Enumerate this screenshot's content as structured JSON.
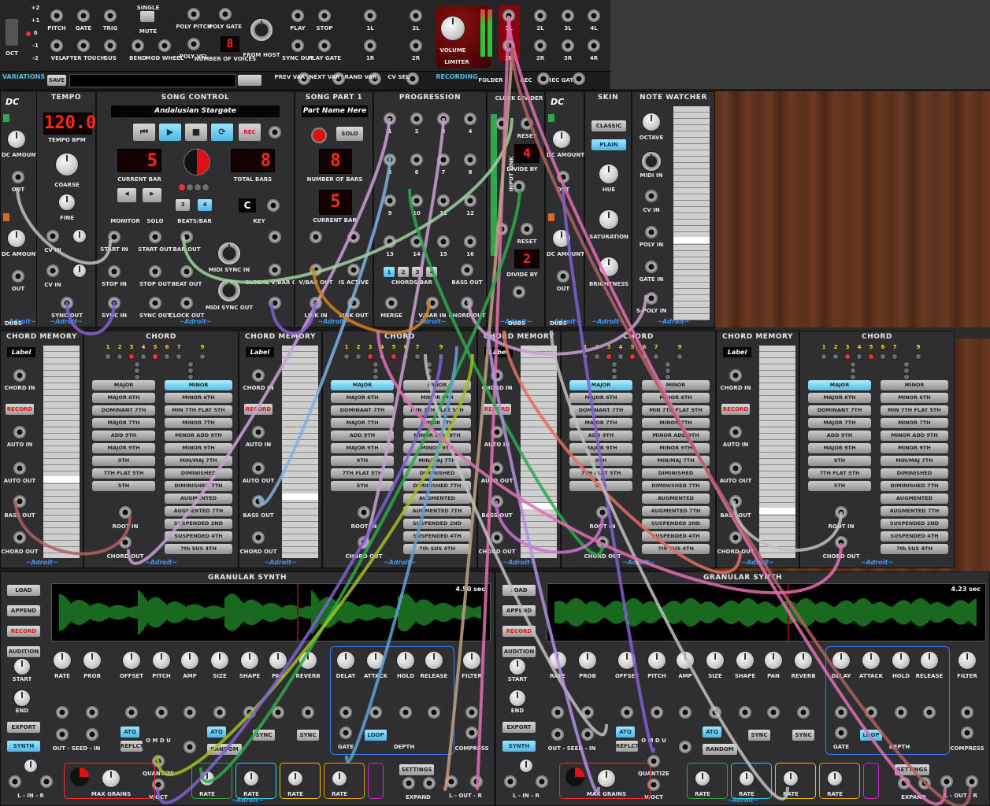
{
  "top": {
    "cv_labels": [
      "PITCH",
      "GATE",
      "TRIG",
      "VEL",
      "AFTER TOUCH",
      "SUS",
      "BEND",
      "MOD WHEEL"
    ],
    "single_label": "SINGLE",
    "mute_label": "MUTE",
    "oct_labels": [
      "+2",
      "+1",
      "0",
      "-1",
      "-2",
      "OCT"
    ],
    "poly_labels": [
      "POLY PITCH",
      "POLY GATE",
      "POLY VEL",
      "NUMBER OF VOICES"
    ],
    "voices": "8",
    "from_host": "FROM HOST",
    "transport_labels": [
      "PLAY",
      "STOP",
      "SYNC OUT",
      "PLAY GATE"
    ],
    "io_labels": [
      "1L",
      "2L",
      "1R",
      "2R"
    ],
    "volume": "VOLUME",
    "limiter": "LIMITER",
    "out_labels": [
      "1L",
      "2L",
      "3L",
      "4L",
      "1R",
      "2R",
      "3R",
      "4R"
    ],
    "variations": "VARIATIONS",
    "save": "SAVE",
    "var_labels": [
      "PREV VAR",
      "NEXT VAR",
      "RAND VAR",
      "CV SEL"
    ],
    "recording": "RECORDING",
    "folder": "FOLDER",
    "rec": "REC",
    "rec_gate": "REC GATE"
  },
  "row1": {
    "dc_labels": [
      "DC AMOUNT",
      "OUT",
      "DC AMOUNT",
      "OUT"
    ],
    "dc_brand": "DUBS",
    "tempo": {
      "title": "TEMPO",
      "bpm": "120.0",
      "bpm_label": "TEMPO BPM",
      "coarse": "COARSE",
      "fine": "FINE",
      "cv_in": "CV IN",
      "sync_out": "SYNC OUT"
    },
    "song": {
      "title": "SONG CONTROL",
      "name": "Andalusian Stargate",
      "current_bar": "5",
      "current_bar_label": "CURRENT BAR",
      "total_bars": "8",
      "total_bars_label": "TOTAL BARS",
      "beats_a": "3",
      "beats_b": "4",
      "beats_label": "BEATS/BAR",
      "monitor": "MONITOR",
      "solo": "SOLO",
      "key": "C",
      "key_label": "KEY",
      "rec": "REC",
      "jacks": [
        "START IN",
        "START OUT",
        "BAR OUT",
        "STOP IN",
        "STOP OUT",
        "BEAT OUT",
        "SYNC IN",
        "SYNC OUT",
        "CLOCK OUT",
        "MIDI SYNC IN",
        "MIDI SYNC OUT",
        "GLOBAL V/BAR OUT"
      ]
    },
    "songpart": {
      "title": "SONG PART 1",
      "name": "Part Name Here",
      "solo": "SOLO",
      "bars": "8",
      "bars_label": "NUMBER OF BARS",
      "cur": "5",
      "cur_label": "CURRENT BAR",
      "jacks": [
        "V/BAR OUT",
        "IS ACTIVE",
        "LINK IN",
        "LINK OUT",
        "LINK OUT"
      ]
    },
    "progression": {
      "title": "PROGRESSION",
      "steps": [
        "1",
        "2",
        "3",
        "4",
        "5",
        "6",
        "7",
        "8",
        "9",
        "10",
        "11",
        "12",
        "13",
        "14",
        "15",
        "16"
      ],
      "chords_label": "CHORDS/BAR",
      "chords": [
        "1",
        "2",
        "3",
        "4"
      ],
      "jacks": [
        "BASS OUT",
        "MERGE",
        "V/BAR IN",
        "CHORD OUT"
      ]
    },
    "clock": {
      "title": "CLOCK DIVIDER",
      "reset": "RESET",
      "div1": "4",
      "div2": "2",
      "divide_by": "DIVIDE BY",
      "input_link": "INPUT LINK",
      "brand": "DUBS"
    },
    "skin": {
      "title": "SKIN",
      "classic": "CLASSIC",
      "plain": "PLAIN",
      "hue": "HUE",
      "saturation": "SATURATION",
      "brightness": "BRIGHTNESS"
    },
    "watcher": {
      "title": "NOTE WATCHER",
      "octave": "OCTAVE",
      "midi_in": "MIDI IN",
      "cv_in": "CV IN",
      "poly_in": "POLY IN",
      "gate_in": "GATE IN",
      "spoly_in": "S-POLY IN"
    }
  },
  "row2": {
    "memory": {
      "title": "CHORD MEMORY",
      "label": "Label",
      "chord_in": "CHORD IN",
      "record": "RECORD",
      "auto_in": "AUTO IN",
      "auto_out": "AUTO OUT",
      "bass_out": "BASS OUT",
      "chord_out": "CHORD OUT"
    },
    "chord": {
      "title": "CHORD",
      "nums": [
        "1",
        "2",
        "3",
        "4",
        "5",
        "6",
        "7",
        "9"
      ],
      "left": [
        "MAJOR",
        "MAJOR 6TH",
        "DOMINANT 7TH",
        "MAJOR 7TH",
        "ADD 9TH",
        "MAJOR 9TH",
        "9TH",
        "7TH FLAT 5TH",
        "5TH"
      ],
      "right": [
        "MINOR",
        "MINOR 6TH",
        "MIN 7TH FLAT 5TH",
        "MINOR 7TH",
        "MINOR ADD 9TH",
        "MINOR 9TH",
        "MIN/MAJ 7TH",
        "DIMINISHED",
        "DIMINISHED 7TH",
        "AUGMENTED",
        "AUGMENTED 7TH",
        "SUSPENDED 2ND",
        "SUSPENDED 4TH",
        "7th SUS 4TH"
      ],
      "root_in": "ROOT IN",
      "chord_out": "CHORD OUT"
    },
    "active": [
      "right-0",
      "left-0",
      "left-0",
      "left-0"
    ]
  },
  "row3": {
    "title": "GRANULAR SYNTH",
    "durations": [
      "4.50 sec",
      "4.23 sec"
    ],
    "side_buttons": [
      "LOAD",
      "APPEND",
      "RECORD",
      "AUDITION"
    ],
    "start": "START",
    "end": "END",
    "export": "EXPORT",
    "synth": "SYNTH",
    "knobs": [
      "RATE",
      "PROB",
      "OFFSET",
      "PITCH",
      "AMP",
      "SIZE",
      "SHAPE",
      "PAN",
      "REVERB",
      "DELAY",
      "ATTACK",
      "HOLD",
      "RELEASE",
      "FILTER"
    ],
    "atq": "ATQ",
    "reflect": "REFLCT",
    "omdu": "O M D U",
    "random": "RANDOM",
    "out_seed": "OUT - SEED - IN",
    "gate": "GATE",
    "loop": "LOOP",
    "depth": "DEPTH",
    "compress": "COMPRESS",
    "sync": "SYNC",
    "quantize": "QUANTIZE",
    "voct": "V/OCT",
    "max_grains": "MAX GRAINS",
    "rate": "RATE",
    "settings": "SETTINGS",
    "expand": "EXPAND",
    "lin": "L - IN - R",
    "lout": "L - OUT - R"
  },
  "brand": "~Adroit~",
  "colors": {
    "panel": "#2f2f31",
    "accent": "#52bde6",
    "led": "#ff2a1a",
    "wave": "#32d23c"
  }
}
